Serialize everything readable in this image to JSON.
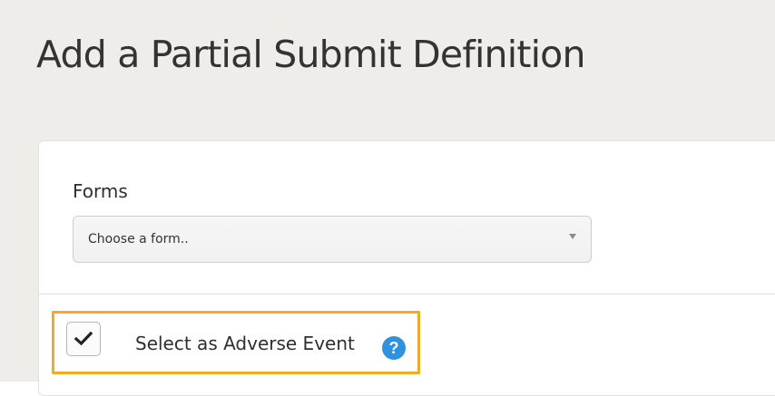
{
  "page": {
    "title": "Add a Partial Submit Definition"
  },
  "form": {
    "forms_label": "Forms",
    "forms_select": {
      "selected": "Choose a form.."
    },
    "adverse_event": {
      "label": "Select as Adverse Event",
      "checked": true
    },
    "help_icon": {
      "name": "question-circle-icon",
      "glyph": "?",
      "color": "#2f92dc"
    }
  },
  "colors": {
    "highlight": "#f2ab22",
    "background": "#efedea",
    "panel": "#ffffff"
  }
}
